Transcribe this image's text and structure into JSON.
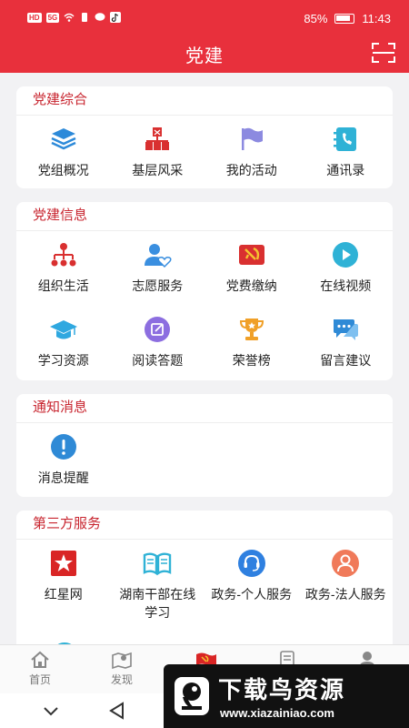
{
  "status_bar": {
    "left_chips": [
      "HD",
      "5G"
    ],
    "battery_percent": "85%",
    "time": "11:43"
  },
  "header": {
    "title": "党建"
  },
  "sections": [
    {
      "title": "党建综合",
      "items": [
        {
          "label": "党组概况",
          "icon": "layers-icon"
        },
        {
          "label": "基层风采",
          "icon": "org-building-icon"
        },
        {
          "label": "我的活动",
          "icon": "flag-icon"
        },
        {
          "label": "通讯录",
          "icon": "contacts-book-icon"
        }
      ]
    },
    {
      "title": "党建信息",
      "items": [
        {
          "label": "组织生活",
          "icon": "org-tree-icon"
        },
        {
          "label": "志愿服务",
          "icon": "volunteer-heart-icon"
        },
        {
          "label": "党费缴纳",
          "icon": "party-emblem-icon"
        },
        {
          "label": "在线视频",
          "icon": "play-icon"
        },
        {
          "label": "学习资源",
          "icon": "graduation-cap-icon"
        },
        {
          "label": "阅读答题",
          "icon": "edit-note-icon"
        },
        {
          "label": "荣誉榜",
          "icon": "trophy-icon"
        },
        {
          "label": "留言建议",
          "icon": "chat-icon"
        }
      ]
    },
    {
      "title": "通知消息",
      "items": [
        {
          "label": "消息提醒",
          "icon": "alert-icon"
        }
      ]
    },
    {
      "title": "第三方服务",
      "items": [
        {
          "label": "红星网",
          "icon": "red-star-icon"
        },
        {
          "label": "湖南干部在线学习",
          "icon": "open-book-icon"
        },
        {
          "label": "政务-个人服务",
          "icon": "headset-icon"
        },
        {
          "label": "政务-法人服务",
          "icon": "person-service-icon"
        }
      ]
    }
  ],
  "tab_bar": [
    {
      "label": "首页",
      "icon": "home-icon"
    },
    {
      "label": "发现",
      "icon": "map-pin-icon"
    },
    {
      "label": "",
      "icon": "party-flag-icon"
    },
    {
      "label": "",
      "icon": "document-icon"
    },
    {
      "label": "",
      "icon": "user-icon"
    }
  ],
  "watermark": {
    "title": "下载鸟资源",
    "url": "www.xiazainiao.com"
  },
  "colors": {
    "brand_red": "#e8303c",
    "section_title": "#c8252f"
  }
}
